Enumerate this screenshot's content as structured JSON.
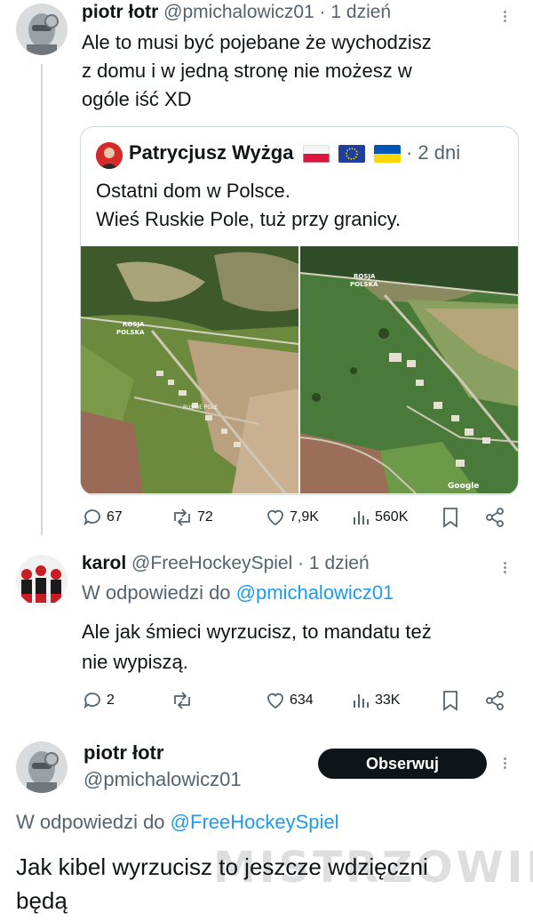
{
  "tweet1": {
    "author": "piotr łotr",
    "handle_time": "@pmichalowicz01 · 1 dzień",
    "text_lines": [
      "Ale to musi być pojebane że wychodzisz",
      "z domu i w jedną stronę nie możesz w",
      "ogóle iść XD"
    ],
    "quote": {
      "author": "Patrycjusz Wyżga",
      "time": "· 2 dni",
      "text_lines": [
        "Ostatni dom w Polsce.",
        "Wieś Ruskie Pole, tuż przy granicy."
      ],
      "map_left_labels": {
        "border_top": "ROSJA",
        "border_bottom": "POLSKA",
        "village": "RUSKIE POLE"
      },
      "map_right_labels": {
        "border_top": "ROSJA",
        "border_bottom": "POLSKA",
        "credit": "Google"
      }
    },
    "stats": {
      "replies": "67",
      "retweets": "72",
      "likes": "7,9K",
      "views": "560K"
    }
  },
  "tweet2": {
    "author": "karol",
    "handle_time": "@FreeHockeySpiel · 1 dzień",
    "reply_prefix": "W odpowiedzi do",
    "reply_to": "@pmichalowicz01",
    "text_lines": [
      "Ale jak śmieci wyrzucisz, to mandatu też",
      "nie wypiszą."
    ],
    "stats": {
      "replies": "2",
      "retweets": "",
      "likes": "634",
      "views": "33K"
    }
  },
  "tweet3": {
    "author": "piotr łotr",
    "handle": "@pmichalowicz01",
    "follow_label": "Obserwuj",
    "reply_prefix": "W odpowiedzi do",
    "reply_to": "@FreeHockeySpiel",
    "text_lines": [
      "Jak kibel wyrzucisz to jeszcze wdzięczni",
      "będą"
    ]
  },
  "watermark": "MISTRZOWIE"
}
